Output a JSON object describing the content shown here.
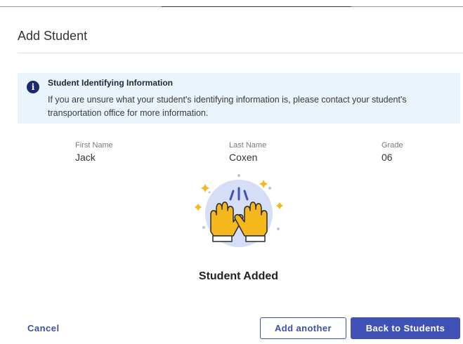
{
  "modal": {
    "title": "Add Student"
  },
  "info": {
    "icon": "info-icon",
    "icon_glyph": "i",
    "heading": "Student Identifying Information",
    "text": "If you are unsure what your student's identifying information is, please contact your student's transportation office for more information."
  },
  "student": {
    "first_name_label": "First Name",
    "first_name": "Jack",
    "last_name_label": "Last Name",
    "last_name": "Coxen",
    "grade_label": "Grade",
    "grade": "06"
  },
  "status": {
    "message": "Student Added",
    "illustration": "raised-hands-celebration-icon"
  },
  "actions": {
    "cancel": "Cancel",
    "add_another": "Add another",
    "back": "Back to Students"
  },
  "colors": {
    "primary": "#3f51b5",
    "info_bg": "#eaf4fc",
    "info_icon": "#1b2a6b",
    "hands": "#f5b81c"
  }
}
